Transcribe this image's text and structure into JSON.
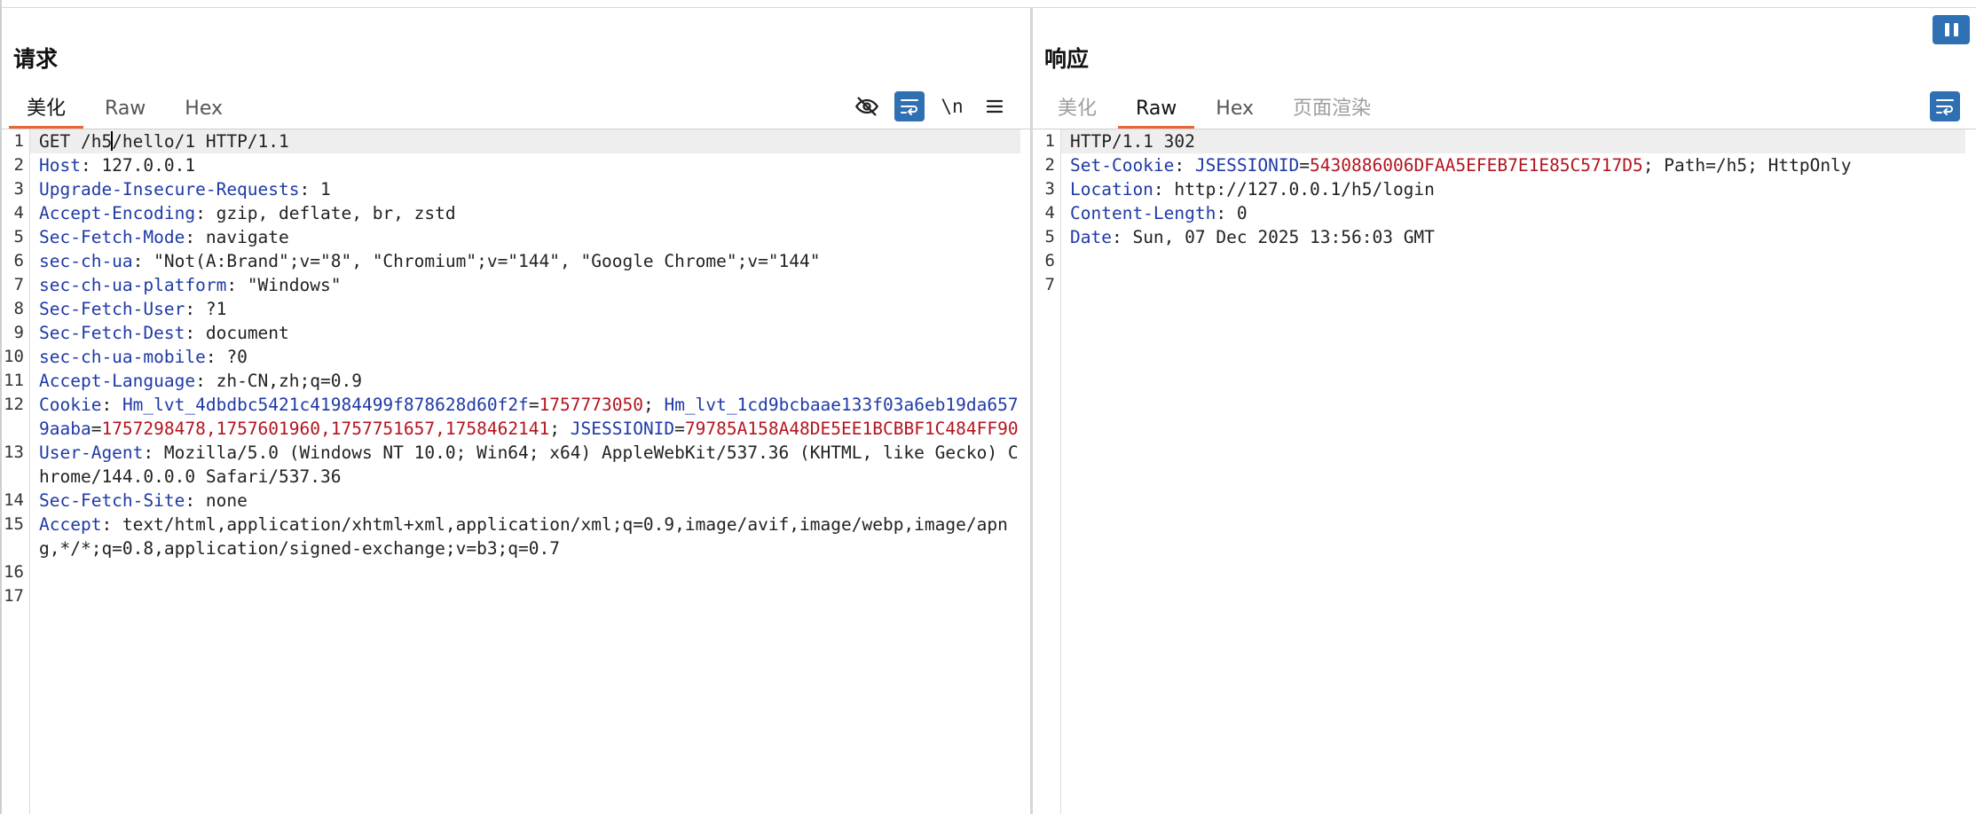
{
  "request": {
    "title": "请求",
    "tabs": [
      {
        "label": "美化",
        "active": true
      },
      {
        "label": "Raw",
        "active": false
      },
      {
        "label": "Hex",
        "active": false
      }
    ],
    "toolbar": {
      "hide_icon": "eye-slash-icon",
      "wrap_icon": "word-wrap-icon",
      "newline_label": "\\n",
      "menu_icon": "hamburger-menu-icon"
    },
    "lines": [
      {
        "n": "1",
        "segs": [
          {
            "t": "GET /h5",
            "c": "v"
          },
          {
            "t": "/hello/1 HTTP/1.1",
            "c": "v"
          }
        ]
      },
      {
        "n": "2",
        "segs": [
          {
            "t": "Host",
            "c": "k"
          },
          {
            "t": ": 127.0.0.1",
            "c": "v"
          }
        ]
      },
      {
        "n": "3",
        "segs": [
          {
            "t": "Upgrade-Insecure-Requests",
            "c": "k"
          },
          {
            "t": ": 1",
            "c": "v"
          }
        ]
      },
      {
        "n": "4",
        "segs": [
          {
            "t": "Accept-Encoding",
            "c": "k"
          },
          {
            "t": ": gzip, deflate, br, zstd",
            "c": "v"
          }
        ]
      },
      {
        "n": "5",
        "segs": [
          {
            "t": "Sec-Fetch-Mode",
            "c": "k"
          },
          {
            "t": ": navigate",
            "c": "v"
          }
        ]
      },
      {
        "n": "6",
        "segs": [
          {
            "t": "sec-ch-ua",
            "c": "k"
          },
          {
            "t": ": \"Not(A:Brand\";v=\"8\", \"Chromium\";v=\"144\", \"Google Chrome\";v=\"144\"",
            "c": "v"
          }
        ]
      },
      {
        "n": "7",
        "segs": [
          {
            "t": "sec-ch-ua-platform",
            "c": "k"
          },
          {
            "t": ": \"Windows\"",
            "c": "v"
          }
        ]
      },
      {
        "n": "8",
        "segs": [
          {
            "t": "Sec-Fetch-User",
            "c": "k"
          },
          {
            "t": ": ?1",
            "c": "v"
          }
        ]
      },
      {
        "n": "9",
        "segs": [
          {
            "t": "Sec-Fetch-Dest",
            "c": "k"
          },
          {
            "t": ": document",
            "c": "v"
          }
        ]
      },
      {
        "n": "10",
        "segs": [
          {
            "t": "sec-ch-ua-mobile",
            "c": "k"
          },
          {
            "t": ": ?0",
            "c": "v"
          }
        ]
      },
      {
        "n": "11",
        "segs": [
          {
            "t": "Accept-Language",
            "c": "k"
          },
          {
            "t": ": zh-CN,zh;q=0.9",
            "c": "v"
          }
        ]
      },
      {
        "n": "12",
        "segs": [
          {
            "t": "Cookie",
            "c": "k"
          },
          {
            "t": ": ",
            "c": "v"
          },
          {
            "t": "Hm_lvt_4dbdbc5421c41984499f878628d60f2f",
            "c": "ck"
          },
          {
            "t": "=",
            "c": "v"
          },
          {
            "t": "1757773050",
            "c": "cv"
          },
          {
            "t": "; ",
            "c": "v"
          },
          {
            "t": "Hm_lvt_1cd9bcbaae133f03a6eb19da6579aaba",
            "c": "ck"
          },
          {
            "t": "=",
            "c": "v"
          },
          {
            "t": "1757298478,1757601960,1757751657,1758462141",
            "c": "cv"
          },
          {
            "t": "; ",
            "c": "v"
          },
          {
            "t": "JSESSIONID",
            "c": "ck"
          },
          {
            "t": "=",
            "c": "v"
          },
          {
            "t": "79785A158A48DE5EE1BCBBF1C484FF90",
            "c": "cv"
          }
        ]
      },
      {
        "n": "13",
        "segs": [
          {
            "t": "User-Agent",
            "c": "k"
          },
          {
            "t": ": Mozilla/5.0 (Windows NT 10.0; Win64; x64) AppleWebKit/537.36 (KHTML, like Gecko) Chrome/144.0.0.0 Safari/537.36",
            "c": "v"
          }
        ]
      },
      {
        "n": "14",
        "segs": [
          {
            "t": "Sec-Fetch-Site",
            "c": "k"
          },
          {
            "t": ": none",
            "c": "v"
          }
        ]
      },
      {
        "n": "15",
        "segs": [
          {
            "t": "Accept",
            "c": "k"
          },
          {
            "t": ": text/html,application/xhtml+xml,application/xml;q=0.9,image/avif,image/webp,image/apng,*/*;q=0.8,application/signed-exchange;v=b3;q=0.7",
            "c": "v"
          }
        ]
      },
      {
        "n": "16",
        "segs": []
      },
      {
        "n": "17",
        "segs": []
      }
    ]
  },
  "response": {
    "title": "响应",
    "tabs": [
      {
        "label": "美化",
        "active": false,
        "disabled": true
      },
      {
        "label": "Raw",
        "active": true
      },
      {
        "label": "Hex",
        "active": false
      },
      {
        "label": "页面渲染",
        "active": false,
        "disabled": true
      }
    ],
    "toolbar": {
      "wrap_icon": "word-wrap-icon"
    },
    "lines": [
      {
        "n": "1",
        "segs": [
          {
            "t": "HTTP/1.1 302",
            "c": "v"
          }
        ]
      },
      {
        "n": "2",
        "segs": [
          {
            "t": "Set-Cookie",
            "c": "k"
          },
          {
            "t": ": ",
            "c": "v"
          },
          {
            "t": "JSESSIONID",
            "c": "ck"
          },
          {
            "t": "=",
            "c": "v"
          },
          {
            "t": "5430886006DFAA5EFEB7E1E85C5717D5",
            "c": "cv"
          },
          {
            "t": "; Path=/h5; HttpOnly",
            "c": "v"
          }
        ]
      },
      {
        "n": "3",
        "segs": [
          {
            "t": "Location",
            "c": "k"
          },
          {
            "t": ": http://127.0.0.1/h5/login",
            "c": "v"
          }
        ]
      },
      {
        "n": "4",
        "segs": [
          {
            "t": "Content-Length",
            "c": "k"
          },
          {
            "t": ": 0",
            "c": "v"
          }
        ]
      },
      {
        "n": "5",
        "segs": [
          {
            "t": "Date",
            "c": "k"
          },
          {
            "t": ": Sun, 07 Dec 2025 13:56:03 GMT",
            "c": "v"
          }
        ]
      },
      {
        "n": "6",
        "segs": []
      },
      {
        "n": "7",
        "segs": []
      }
    ]
  },
  "pause_button_icon": "pause-icon",
  "colors": {
    "accent": "#e8663a",
    "button": "#2f6fb3",
    "header_key": "#1f3aa6",
    "cookie_value": "#b3141f"
  }
}
